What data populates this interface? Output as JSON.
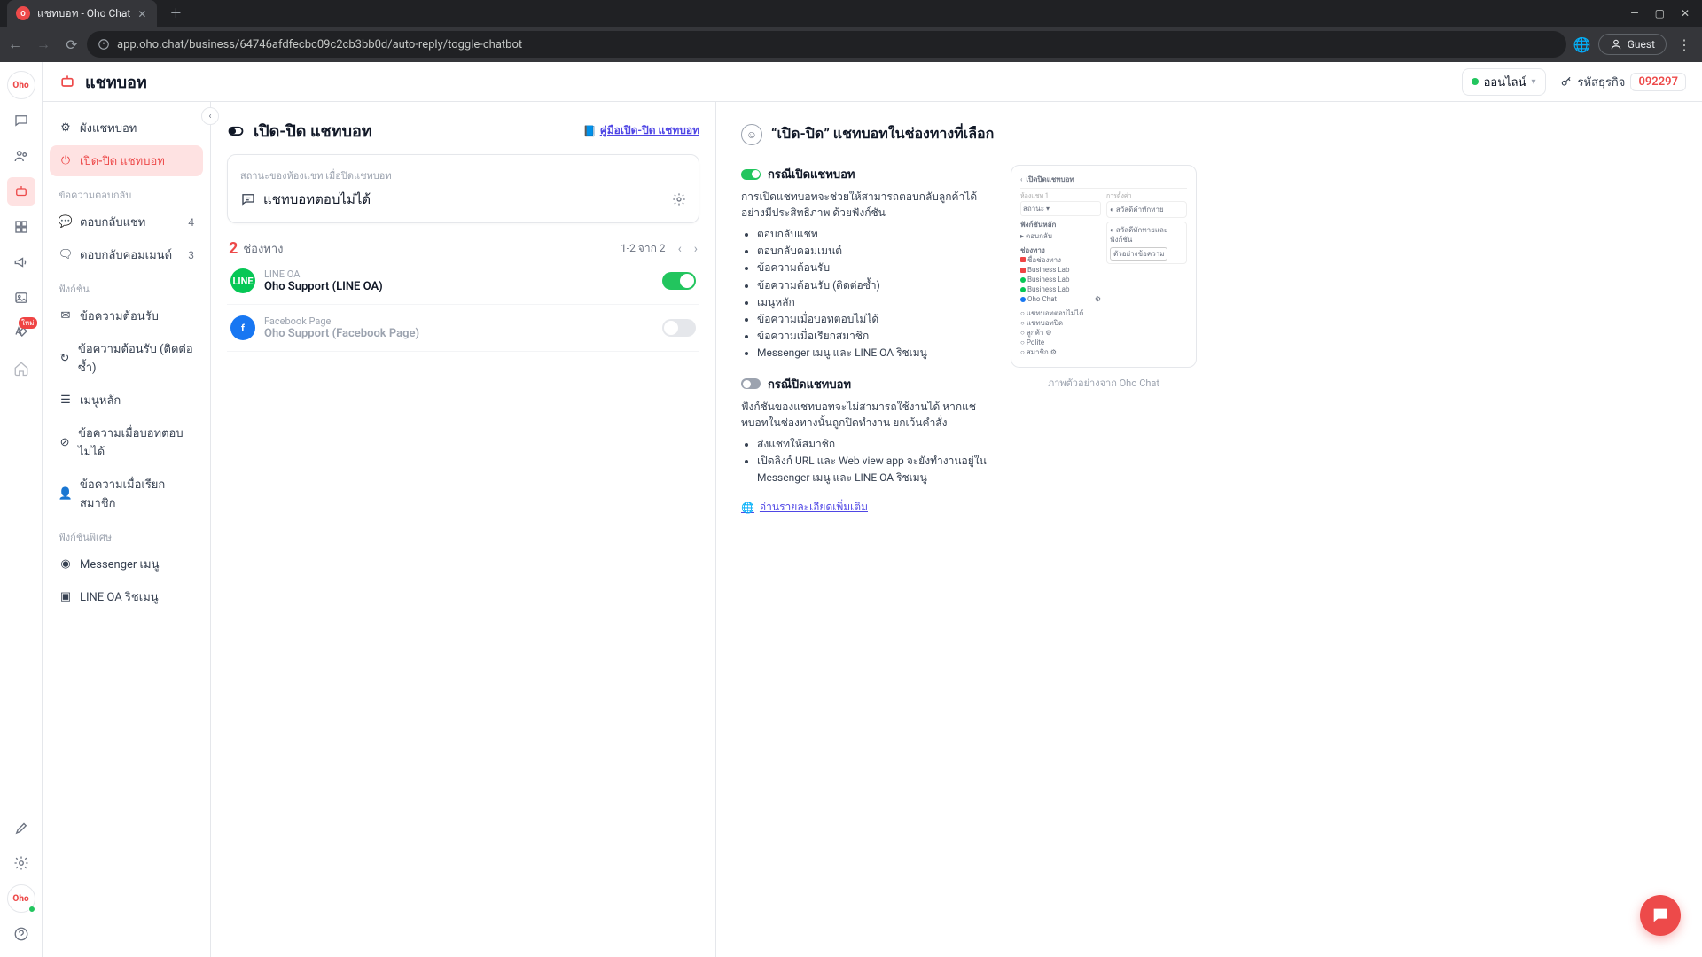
{
  "browser": {
    "tab_title": "แชทบอท - Oho Chat",
    "url": "app.oho.chat/business/64746afdfecbc09c2cb3bb0d/auto-reply/toggle-chatbot",
    "guest_label": "Guest"
  },
  "topbar": {
    "title": "แชทบอท",
    "status_label": "ออนไลน์",
    "biz_id_label": "รหัสธุรกิจ",
    "biz_id_value": "092297"
  },
  "sidebar": {
    "items_main": [
      {
        "label": "ผังแชทบอท",
        "active": false
      },
      {
        "label": "เปิด-ปิด แชทบอท",
        "active": true
      }
    ],
    "section_reply": "ข้อความตอบกลับ",
    "items_reply": [
      {
        "label": "ตอบกลับแชท",
        "count": "4"
      },
      {
        "label": "ตอบกลับคอมเมนต์",
        "count": "3"
      }
    ],
    "section_func": "ฟังก์ชัน",
    "items_func": [
      "ข้อความต้อนรับ",
      "ข้อความต้อนรับ (ติดต่อซ้ำ)",
      "เมนูหลัก",
      "ข้อความเมื่อบอทตอบไม่ได้",
      "ข้อความเมื่อเรียกสมาชิก"
    ],
    "section_special": "ฟังก์ชันพิเศษ",
    "items_special": [
      "Messenger เมนู",
      "LINE OA ริชเมนู"
    ]
  },
  "center": {
    "title": "เปิด-ปิด แชทบอท",
    "guide": "คู่มือเปิด‑ปิด แชทบอท",
    "card_label": "สถานะของห้องแชท เมื่อปิดแชทบอท",
    "card_value": "แชทบอทตอบไม่ได้",
    "paging": {
      "count": "2",
      "label": "ช่องทาง",
      "range": "1-2 จาก 2"
    },
    "channels": [
      {
        "kind": "line",
        "sub": "LINE OA",
        "title": "Oho Support (LINE OA)",
        "on": true
      },
      {
        "kind": "fb",
        "sub": "Facebook Page",
        "title": "Oho Support (Facebook Page)",
        "on": false
      }
    ]
  },
  "info": {
    "heading": "“เปิด-ปิด” แชทบอทในช่องทางที่เลือก",
    "on_label": "กรณีเปิดแชทบอท",
    "on_desc": "การเปิดแชทบอทจะช่วยให้สามารถตอบกลับลูกค้าได้อย่างมีประสิทธิภาพ ด้วยฟังก์ชัน",
    "on_list": [
      "ตอบกลับแชท",
      "ตอบกลับคอมเมนต์",
      "ข้อความต้อนรับ",
      "ข้อความต้อนรับ (ติดต่อซ้ำ)",
      "เมนูหลัก",
      "ข้อความเมื่อบอทตอบไม่ได้",
      "ข้อความเมื่อเรียกสมาชิก",
      "Messenger เมนู และ LINE OA ริชเมนู"
    ],
    "off_label": "กรณีปิดแชทบอท",
    "off_desc": "ฟังก์ชันของแชทบอทจะไม่สามารถใช้งานได้ หากแชทบอทในช่องทางนั้นถูกปิดทำงาน ยกเว้นคำสั่ง",
    "off_list": [
      "ส่งแชทให้สมาชิก",
      "เปิดลิงก์ URL และ Web view app จะยังทำงานอยู่ใน Messenger เมนู และ LINE OA ริชเมนู"
    ],
    "more": "อ่านรายละเอียดเพิ่มเติม",
    "caption": "ภาพตัวอย่างจาก Oho Chat"
  }
}
